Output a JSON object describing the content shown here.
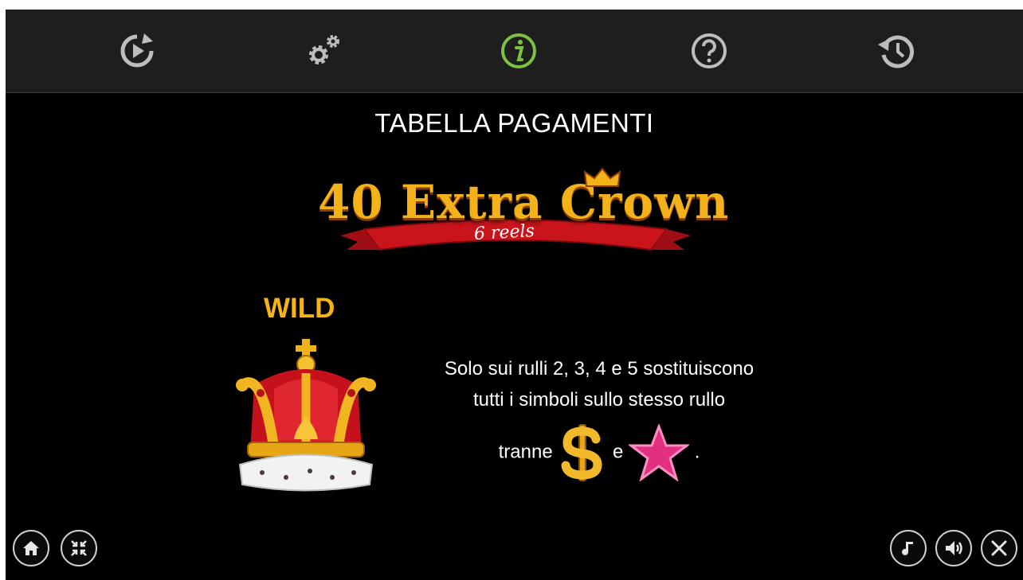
{
  "toolbar": {
    "icons": [
      {
        "name": "autoplay-icon",
        "active": false
      },
      {
        "name": "settings-icon",
        "active": false
      },
      {
        "name": "info-icon",
        "active": true
      },
      {
        "name": "help-icon",
        "active": false
      },
      {
        "name": "history-icon",
        "active": false
      }
    ],
    "active_color": "#7dc142",
    "inactive_color": "#bdbdbd"
  },
  "page": {
    "title": "TABELLA PAGAMENTI"
  },
  "logo": {
    "main_text": "40 Extra Crown",
    "sub_text": "6 reels"
  },
  "symbol": {
    "label": "WILD",
    "label_color": "#f5b316",
    "icon": "crown-icon"
  },
  "description": {
    "line1": "Solo sui rulli 2, 3, 4 e 5 sostituiscono",
    "line2": "tutti i simboli sullo stesso rullo",
    "line3_prefix": "tranne",
    "line3_joiner": "e",
    "line3_suffix": ".",
    "excluded_symbols": [
      "dollar-icon",
      "star-icon"
    ]
  },
  "bottom_left": [
    "home-icon",
    "fullscreen-exit-icon"
  ],
  "bottom_right": [
    "music-icon",
    "sound-icon",
    "close-icon"
  ]
}
